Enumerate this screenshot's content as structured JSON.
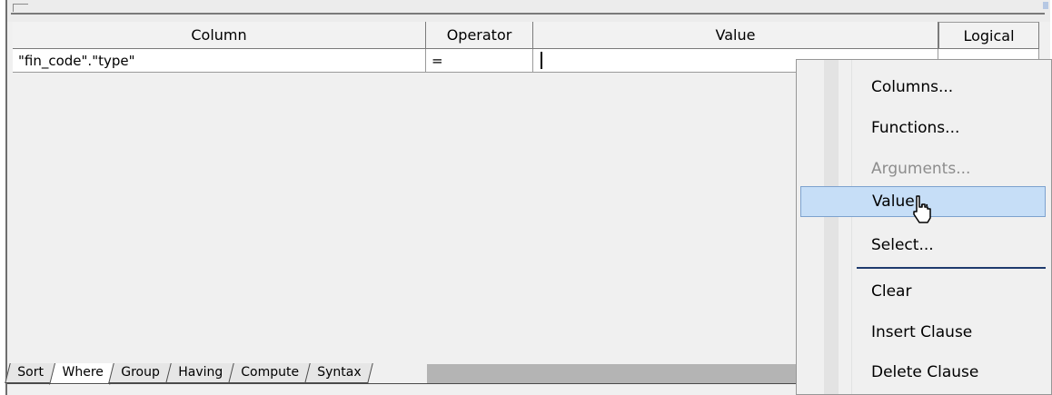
{
  "grid": {
    "headers": [
      "Column",
      "Operator",
      "Value",
      "Logical"
    ],
    "rows": [
      {
        "column": "\"fin_code\".\"type\"",
        "operator": "=",
        "value": "",
        "logical": ""
      }
    ]
  },
  "tabs": [
    "Sort",
    "Where",
    "Group",
    "Having",
    "Compute",
    "Syntax"
  ],
  "active_tab": "Where",
  "context_menu": {
    "items": [
      {
        "label": "Columns...",
        "enabled": true
      },
      {
        "label": "Functions...",
        "enabled": true
      },
      {
        "label": "Arguments...",
        "enabled": false
      },
      {
        "label": "Value...",
        "enabled": true,
        "highlighted": true
      },
      {
        "label": "Select...",
        "enabled": true
      },
      {
        "label": "Clear",
        "enabled": true
      },
      {
        "label": "Insert Clause",
        "enabled": true
      },
      {
        "label": "Delete Clause",
        "enabled": true
      }
    ]
  },
  "colors": {
    "highlight_bg": "#c6def7",
    "highlight_border": "#7da2ce",
    "separator": "#1f3b6e"
  }
}
